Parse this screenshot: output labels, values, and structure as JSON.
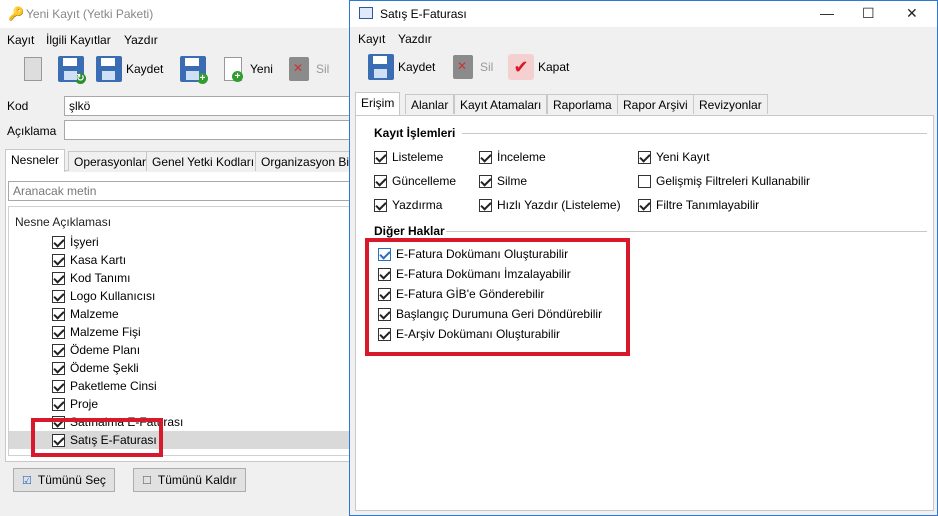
{
  "back_window": {
    "title": "Yeni Kayıt (Yetki Paketi)",
    "menu": [
      "Kayıt",
      "İlgili Kayıtlar",
      "Yazdır"
    ],
    "toolbar": {
      "save": "Kaydet",
      "new": "Yeni",
      "delete": "Sil"
    },
    "kod_label": "Kod",
    "kod_value": "şlkö",
    "aciklama_label": "Açıklama",
    "aciklama_value": "",
    "tabs": [
      "Nesneler",
      "Operasyonlar",
      "Genel Yetki Kodları",
      "Organizasyon Bir"
    ],
    "search_placeholder": "Aranacak metin",
    "list_header": "Nesne Açıklaması",
    "items": [
      {
        "label": "İşyeri",
        "checked": true
      },
      {
        "label": "Kasa Kartı",
        "checked": true
      },
      {
        "label": "Kod Tanımı",
        "checked": true
      },
      {
        "label": "Logo Kullanıcısı",
        "checked": true
      },
      {
        "label": "Malzeme",
        "checked": true
      },
      {
        "label": "Malzeme Fişi",
        "checked": true
      },
      {
        "label": "Ödeme Planı",
        "checked": true
      },
      {
        "label": "Ödeme Şekli",
        "checked": true
      },
      {
        "label": "Paketleme Cinsi",
        "checked": true
      },
      {
        "label": "Proje",
        "checked": true
      },
      {
        "label": "Satınalma E-Faturası",
        "checked": true
      },
      {
        "label": "Satış E-Faturası",
        "checked": true,
        "selected": true
      }
    ],
    "select_all": "Tümünü Seç",
    "deselect_all": "Tümünü Kaldır"
  },
  "front_window": {
    "title": "Satış E-Faturası",
    "menu": [
      "Kayıt",
      "Yazdır"
    ],
    "toolbar": {
      "save": "Kaydet",
      "delete": "Sil",
      "close": "Kapat"
    },
    "tabs": [
      "Erişim",
      "Alanlar",
      "Kayıt Atamaları",
      "Raporlama",
      "Rapor Arşivi",
      "Revizyonlar"
    ],
    "section1_title": "Kayıt İşlemleri",
    "section1": [
      {
        "label": "Listeleme",
        "checked": true
      },
      {
        "label": "İnceleme",
        "checked": true
      },
      {
        "label": "Yeni Kayıt",
        "checked": true
      },
      {
        "label": "Güncelleme",
        "checked": true
      },
      {
        "label": "Silme",
        "checked": true
      },
      {
        "label": "Gelişmiş Filtreleri Kullanabilir",
        "checked": false
      },
      {
        "label": "Yazdırma",
        "checked": true
      },
      {
        "label": "Hızlı Yazdır (Listeleme)",
        "checked": true
      },
      {
        "label": "Filtre Tanımlayabilir",
        "checked": true
      }
    ],
    "section2_title": "Diğer Haklar",
    "section2": [
      {
        "label": "E-Fatura Dokümanı Oluşturabilir",
        "checked": true
      },
      {
        "label": "E-Fatura Dokümanı İmzalayabilir",
        "checked": true
      },
      {
        "label": "E-Fatura GİB'e Gönderebilir",
        "checked": true
      },
      {
        "label": "Başlangıç Durumuna Geri Döndürebilir",
        "checked": true
      },
      {
        "label": "E-Arşiv Dokümanı Oluşturabilir",
        "checked": true
      }
    ]
  },
  "colors": {
    "highlight": "#d8182b",
    "accent": "#2b79d6"
  }
}
